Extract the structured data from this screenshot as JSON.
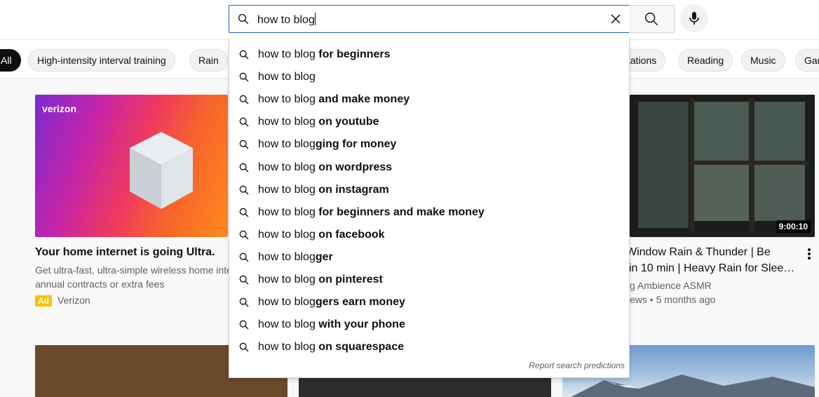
{
  "search": {
    "query": "how to blog",
    "search_icon": "search-icon",
    "clear_icon": "close-icon",
    "mic_icon": "microphone-icon"
  },
  "chips": [
    {
      "label": "All",
      "active": true
    },
    {
      "label": "High-intensity interval training",
      "active": false
    },
    {
      "label": "Rain",
      "active": false
    },
    {
      "label": "tations",
      "active": false
    },
    {
      "label": "Reading",
      "active": false
    },
    {
      "label": "Music",
      "active": false
    },
    {
      "label": "Gar",
      "active": false
    }
  ],
  "suggestions": [
    {
      "prefix": "how to blog",
      "suffix": " for beginners"
    },
    {
      "prefix": "how to blog",
      "suffix": ""
    },
    {
      "prefix": "how to blog",
      "suffix": " and make money"
    },
    {
      "prefix": "how to blog",
      "suffix": " on youtube"
    },
    {
      "prefix": "how to blog",
      "suffix": "ging for money"
    },
    {
      "prefix": "how to blog",
      "suffix": " on wordpress"
    },
    {
      "prefix": "how to blog",
      "suffix": " on instagram"
    },
    {
      "prefix": "how to blog",
      "suffix": " for beginners and make money"
    },
    {
      "prefix": "how to blog",
      "suffix": " on facebook"
    },
    {
      "prefix": "how to blog",
      "suffix": "ger"
    },
    {
      "prefix": "how to blog",
      "suffix": " on pinterest"
    },
    {
      "prefix": "how to blog",
      "suffix": "gers earn money"
    },
    {
      "prefix": "how to blog",
      "suffix": " with your phone"
    },
    {
      "prefix": "how to blog",
      "suffix": " on squarespace"
    }
  ],
  "report_link": "Report search predictions",
  "ad_card": {
    "logo": "verizon",
    "title": "Your home internet is going Ultra.",
    "desc_line1": "Get ultra-fast, ultra-simple wireless home inte",
    "desc_line2": "annual contracts or extra fees",
    "badge": "Ad",
    "channel": "Verizon"
  },
  "video_card": {
    "duration": "9:00:10",
    "title_line1": "Window Rain & Thunder | Be",
    "title_line2": " in 10 min | Heavy Rain for Slee…",
    "channel": "g Ambience ASMR",
    "meta": "ews • 5 months ago",
    "menu_icon": "more-vert-icon"
  }
}
